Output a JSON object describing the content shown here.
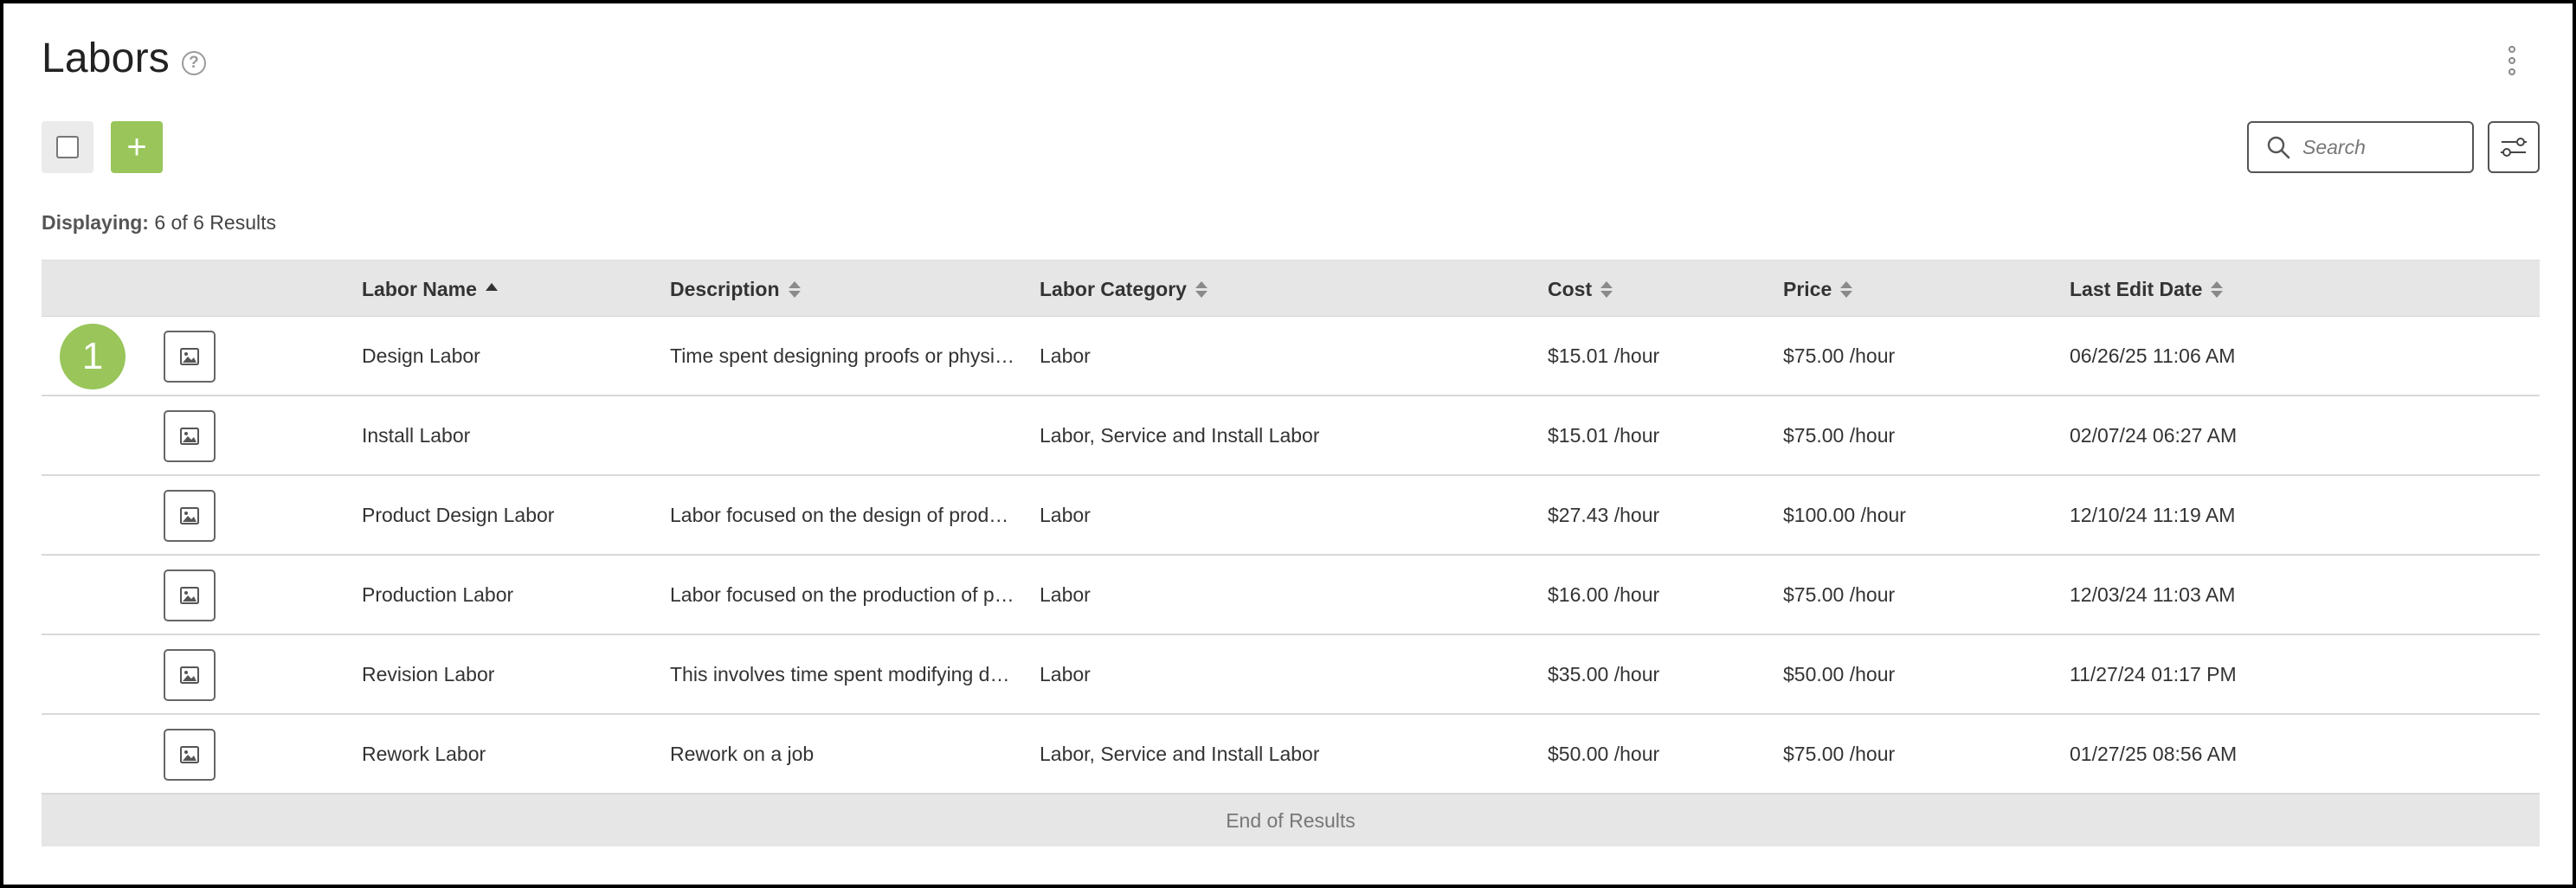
{
  "header": {
    "title": "Labors",
    "help_icon": "question-circle-icon",
    "more_icon": "kebab-icon"
  },
  "toolbar": {
    "select_all_icon": "checkbox-icon",
    "add_label": "+",
    "search_placeholder": "Search",
    "search_value": "",
    "filter_icon": "sliders-icon"
  },
  "summary": {
    "label": "Displaying:",
    "value": "6 of 6 Results"
  },
  "table": {
    "columns": [
      {
        "key": "name",
        "label": "Labor Name",
        "sort": "asc"
      },
      {
        "key": "description",
        "label": "Description",
        "sort": "none"
      },
      {
        "key": "category",
        "label": "Labor Category",
        "sort": "none"
      },
      {
        "key": "cost",
        "label": "Cost",
        "sort": "none"
      },
      {
        "key": "price",
        "label": "Price",
        "sort": "none"
      },
      {
        "key": "last_edit",
        "label": "Last Edit Date",
        "sort": "none"
      }
    ],
    "rows": [
      {
        "name": "Design Labor",
        "description": "Time spent designing proofs or physical samples",
        "category": "Labor",
        "cost": "$15.01 /hour",
        "price": "$75.00 /hour",
        "last_edit": "06/26/25 11:06 AM"
      },
      {
        "name": "Install Labor",
        "description": "",
        "category": "Labor, Service and Install Labor",
        "cost": "$15.01 /hour",
        "price": "$75.00 /hour",
        "last_edit": "02/07/24 06:27 AM"
      },
      {
        "name": "Product Design Labor",
        "description": "Labor focused on the design of products",
        "category": "Labor",
        "cost": "$27.43 /hour",
        "price": "$100.00 /hour",
        "last_edit": "12/10/24 11:19 AM"
      },
      {
        "name": "Production Labor",
        "description": "Labor focused on the production of products",
        "category": "Labor",
        "cost": "$16.00 /hour",
        "price": "$75.00 /hour",
        "last_edit": "12/03/24 11:03 AM"
      },
      {
        "name": "Revision Labor",
        "description": "This involves time spent modifying designs",
        "category": "Labor",
        "cost": "$35.00 /hour",
        "price": "$50.00 /hour",
        "last_edit": "11/27/24 01:17 PM"
      },
      {
        "name": "Rework Labor",
        "description": "Rework on a job",
        "category": "Labor, Service and Install Labor",
        "cost": "$50.00 /hour",
        "price": "$75.00 /hour",
        "last_edit": "01/27/25 08:56 AM"
      }
    ],
    "thumbnail_icon": "image-icon",
    "footer": "End of Results"
  },
  "step_badge": "1",
  "colors": {
    "accent": "#99c55a",
    "header_bg": "#e6e6e6",
    "text": "#333333"
  }
}
